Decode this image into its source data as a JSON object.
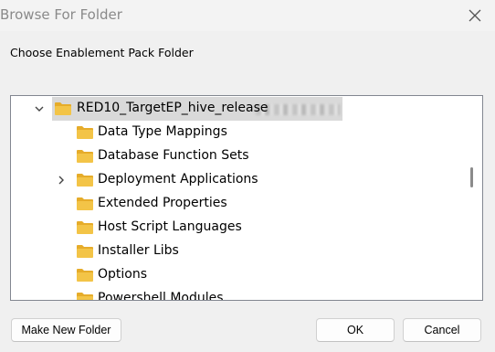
{
  "window": {
    "title": "Browse For Folder",
    "close_icon": "close-icon"
  },
  "prompt": "Choose Enablement Pack Folder",
  "tree": {
    "root": {
      "label": "RED10_TargetEP_hive_release",
      "expanded": true,
      "selected": true,
      "icon": "folder-icon"
    },
    "children": [
      {
        "label": "Data Type Mappings",
        "has_children": false
      },
      {
        "label": "Database Function Sets",
        "has_children": false
      },
      {
        "label": "Deployment Applications",
        "has_children": true
      },
      {
        "label": "Extended Properties",
        "has_children": false
      },
      {
        "label": "Host Script Languages",
        "has_children": false
      },
      {
        "label": "Installer Libs",
        "has_children": false
      },
      {
        "label": "Options",
        "has_children": false
      },
      {
        "label": "Powershell Modules",
        "has_children": false
      }
    ]
  },
  "buttons": {
    "make_new_folder": "Make New Folder",
    "ok": "OK",
    "cancel": "Cancel"
  },
  "colors": {
    "folder_body": "#f3c447",
    "folder_tab": "#e6ac2a",
    "selection": "#d9d9d9",
    "dialog_background": "#f0f0f0"
  }
}
